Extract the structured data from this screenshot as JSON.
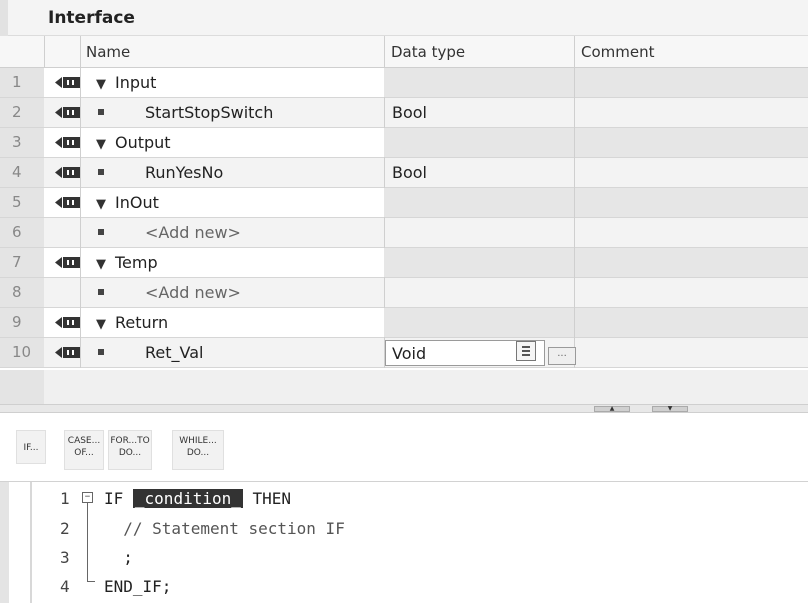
{
  "interface": {
    "title": "Interface",
    "columns": {
      "name": "Name",
      "data_type": "Data type",
      "comment": "Comment"
    },
    "rows": [
      {
        "num": "1",
        "kind": "section",
        "name": "Input",
        "data_type": ""
      },
      {
        "num": "2",
        "kind": "item",
        "name": "StartStopSwitch",
        "data_type": "Bool"
      },
      {
        "num": "3",
        "kind": "section",
        "name": "Output",
        "data_type": ""
      },
      {
        "num": "4",
        "kind": "item",
        "name": "RunYesNo",
        "data_type": "Bool"
      },
      {
        "num": "5",
        "kind": "section",
        "name": "InOut",
        "data_type": ""
      },
      {
        "num": "6",
        "kind": "add",
        "name": "<Add new>",
        "data_type": ""
      },
      {
        "num": "7",
        "kind": "section",
        "name": "Temp",
        "data_type": ""
      },
      {
        "num": "8",
        "kind": "add",
        "name": "<Add new>",
        "data_type": ""
      },
      {
        "num": "9",
        "kind": "section",
        "name": "Return",
        "data_type": ""
      },
      {
        "num": "10",
        "kind": "item",
        "name": "Ret_Val",
        "data_type": "Void"
      }
    ],
    "void_dots_label": "..."
  },
  "toolbar": {
    "buttons": [
      {
        "line1": "IF...",
        "line2": ""
      },
      {
        "line1": "CASE...",
        "line2": "OF..."
      },
      {
        "line1": "FOR...TO",
        "line2": "DO..."
      },
      {
        "line1": "WHILE...",
        "line2": "DO..."
      }
    ]
  },
  "editor": {
    "lines": [
      {
        "num": "1",
        "before": "IF ",
        "highlight": "_condition_",
        "after": " THEN"
      },
      {
        "num": "2",
        "text": "  // Statement section IF"
      },
      {
        "num": "3",
        "text": "  ;"
      },
      {
        "num": "4",
        "text": "END_IF;"
      }
    ]
  },
  "colors": {
    "background": "#ffffff",
    "header_bg": "#f7f7f7",
    "row_alt": "#f3f3f3",
    "highlight_bg": "#333333"
  }
}
